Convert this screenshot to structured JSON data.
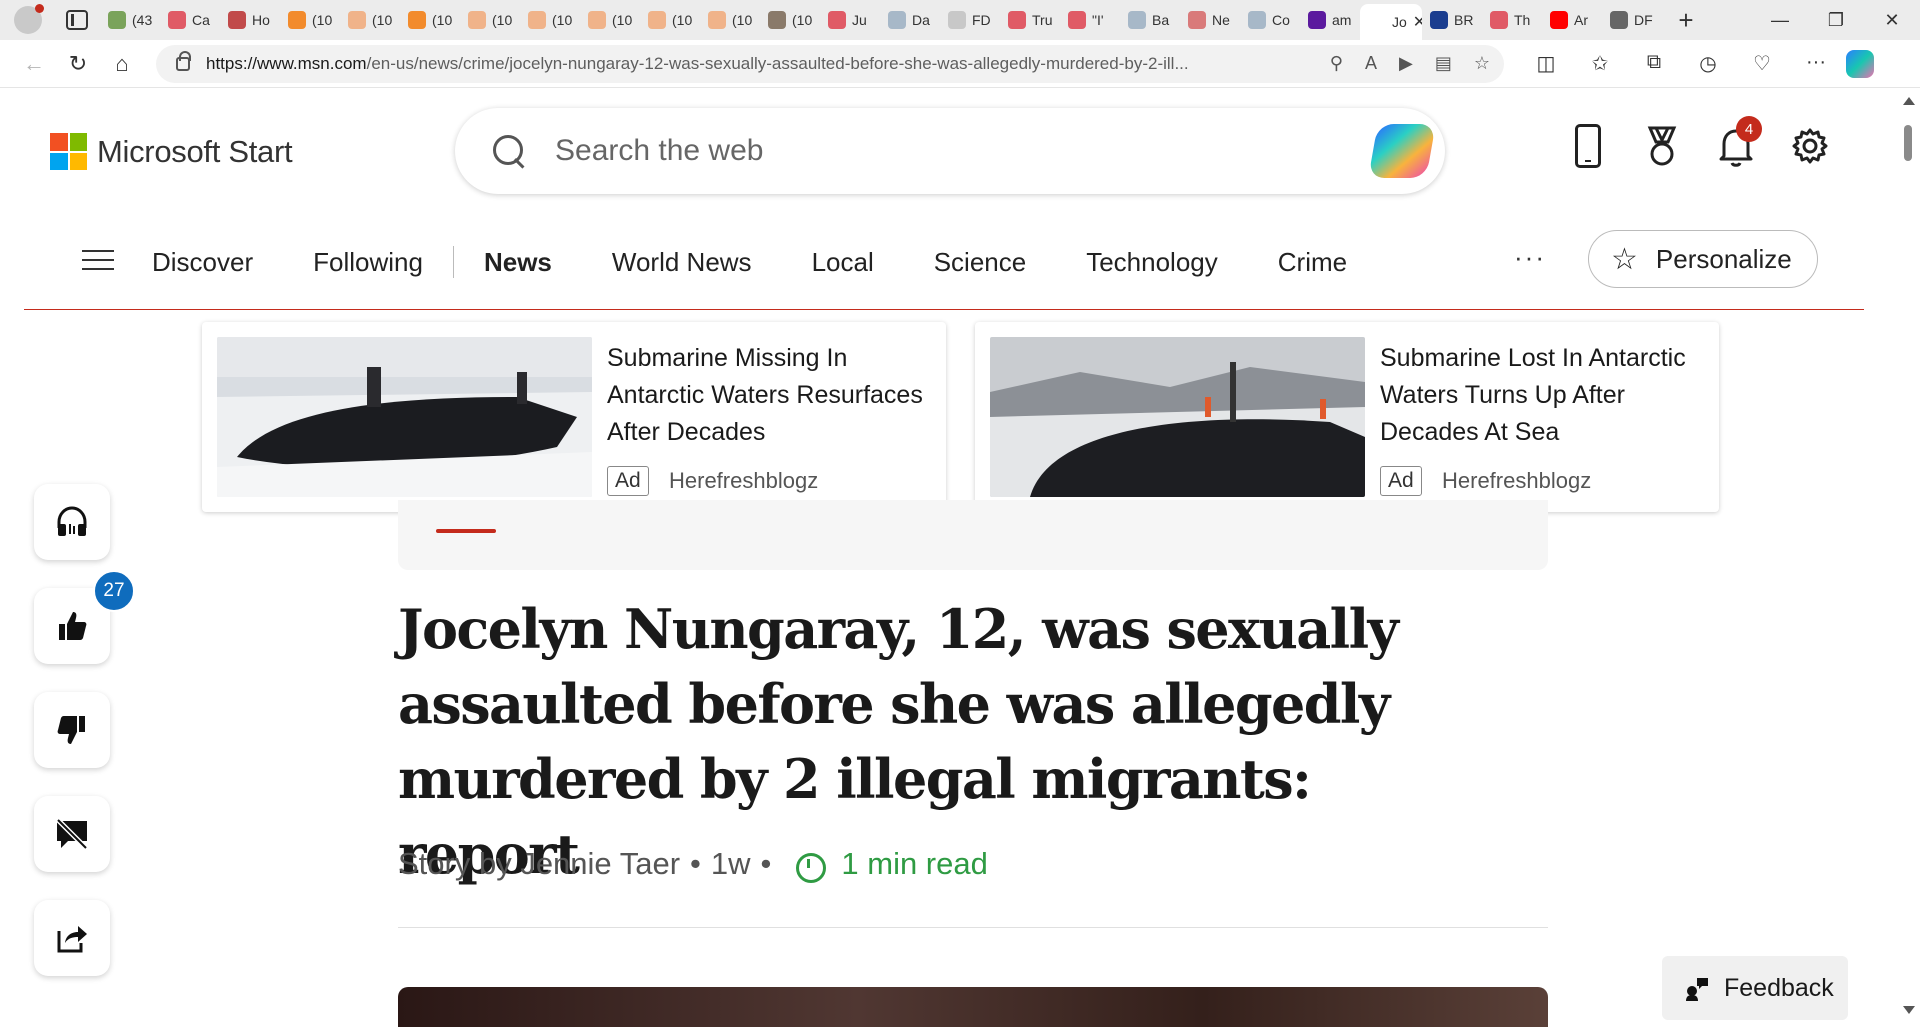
{
  "browser": {
    "tabs": [
      {
        "label": "(43",
        "color": "#7aa35a"
      },
      {
        "label": "Ca",
        "color": "#e05a66"
      },
      {
        "label": "Ho",
        "color": "#c14a4a"
      },
      {
        "label": "(10",
        "color": "#f28b2c"
      },
      {
        "label": "(10",
        "color": "#f0b38a"
      },
      {
        "label": "(10",
        "color": "#f28b2c"
      },
      {
        "label": "(10",
        "color": "#f0b38a"
      },
      {
        "label": "(10",
        "color": "#f0b38a"
      },
      {
        "label": "(10",
        "color": "#f0b38a"
      },
      {
        "label": "(10",
        "color": "#f0b38a"
      },
      {
        "label": "(10",
        "color": "#f0b38a"
      },
      {
        "label": "(10",
        "color": "#8a7a6a"
      },
      {
        "label": "Ju",
        "color": "#e05a66"
      },
      {
        "label": "Da",
        "color": "#a7b8c8"
      },
      {
        "label": "FD",
        "color": "#c8c8c8"
      },
      {
        "label": "Tru",
        "color": "#e05a66"
      },
      {
        "label": "\"I'",
        "color": "#e05a66"
      },
      {
        "label": "Ba",
        "color": "#a7b8c8"
      },
      {
        "label": "Ne",
        "color": "#d97a7a"
      },
      {
        "label": "Co",
        "color": "#a7b8c8"
      },
      {
        "label": "am",
        "color": "#5b1a9e"
      },
      {
        "label": "Jo",
        "color": "#ffffff",
        "active": true
      },
      {
        "label": "BR",
        "color": "#1a3d8f"
      },
      {
        "label": "Th",
        "color": "#e05a66"
      },
      {
        "label": "Ar",
        "color": "#ff0000"
      },
      {
        "label": "DF",
        "color": "#666666"
      }
    ],
    "url_host": "https://www.msn.com",
    "url_path": "/en-us/news/crime/jocelyn-nungaray-12-was-sexually-assaulted-before-she-was-allegedly-murdered-by-2-ill..."
  },
  "header": {
    "brand": "Microsoft Start",
    "search_placeholder": "Search the web",
    "notification_count": "4"
  },
  "nav": {
    "items": [
      "Discover",
      "Following",
      "News",
      "World News",
      "Local",
      "Science",
      "Technology",
      "Crime"
    ],
    "more": "···",
    "personalize": "Personalize"
  },
  "ads": [
    {
      "headline": "Submarine Missing In Antarctic Waters Resurfaces After Decades",
      "tag": "Ad",
      "source": "Herefreshblogz"
    },
    {
      "headline": "Submarine Lost In Antarctic Waters Turns Up After Decades At Sea",
      "tag": "Ad",
      "source": "Herefreshblogz"
    }
  ],
  "article": {
    "title": "Jocelyn Nungaray, 12, was sexually assaulted before she was allegedly murdered by 2 illegal migrants: report",
    "byline": "Story by Jennie Taer",
    "age": "1w",
    "read_time": "1 min read"
  },
  "rail": {
    "like_count": "27"
  },
  "feedback": "Feedback",
  "colors": {
    "accent_red": "#c42b1c",
    "read_green": "#2f9b43",
    "badge_blue": "#0f6cbd"
  }
}
